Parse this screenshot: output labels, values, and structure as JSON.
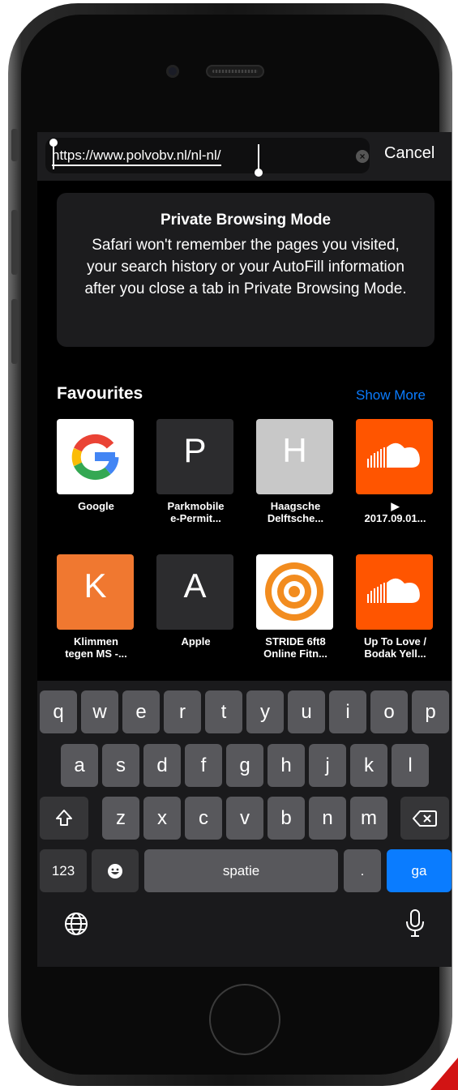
{
  "address_bar": {
    "url_prefix": "https://www.polvobv.nl/nl-nl/",
    "cancel_label": "Cancel"
  },
  "private_card": {
    "title": "Private Browsing Mode",
    "body": "Safari won't remember the pages you visited, your search history or your AutoFill information after you close a tab in Private Browsing Mode."
  },
  "favourites": {
    "title": "Favourites",
    "show_more": "Show More",
    "items": [
      {
        "label1": "Google",
        "label2": "",
        "icon": "google-icon"
      },
      {
        "label1": "Parkmobile",
        "label2": "e-Permit...",
        "letter": "P",
        "bg": "#2c2c2e"
      },
      {
        "label1": "Haagsche",
        "label2": "Delftsche...",
        "letter": "H",
        "bg": "#c8c8c8"
      },
      {
        "label1": "▶",
        "label2": "2017.09.01...",
        "icon": "soundcloud-icon",
        "bg": "#ff5500"
      },
      {
        "label1": "Klimmen",
        "label2": "tegen MS -...",
        "letter": "K",
        "bg": "#f07830"
      },
      {
        "label1": "Apple",
        "label2": "",
        "letter": "A",
        "bg": "#2c2c2e"
      },
      {
        "label1": "STRIDE 6ft8",
        "label2": "Online Fitn...",
        "icon": "target-icon",
        "bg": "#ffffff"
      },
      {
        "label1": "Up To Love /",
        "label2": "Bodak Yell...",
        "icon": "soundcloud-icon",
        "bg": "#ff5500"
      }
    ]
  },
  "keyboard": {
    "row1": [
      "q",
      "w",
      "e",
      "r",
      "t",
      "y",
      "u",
      "i",
      "o",
      "p"
    ],
    "row2": [
      "a",
      "s",
      "d",
      "f",
      "g",
      "h",
      "j",
      "k",
      "l"
    ],
    "row3": [
      "z",
      "x",
      "c",
      "v",
      "b",
      "n",
      "m"
    ],
    "numbers_label": "123",
    "space_label": "spatie",
    "period_label": ".",
    "go_label": "ga"
  },
  "colors": {
    "accent": "#0a7cff",
    "soundcloud": "#ff5500"
  }
}
